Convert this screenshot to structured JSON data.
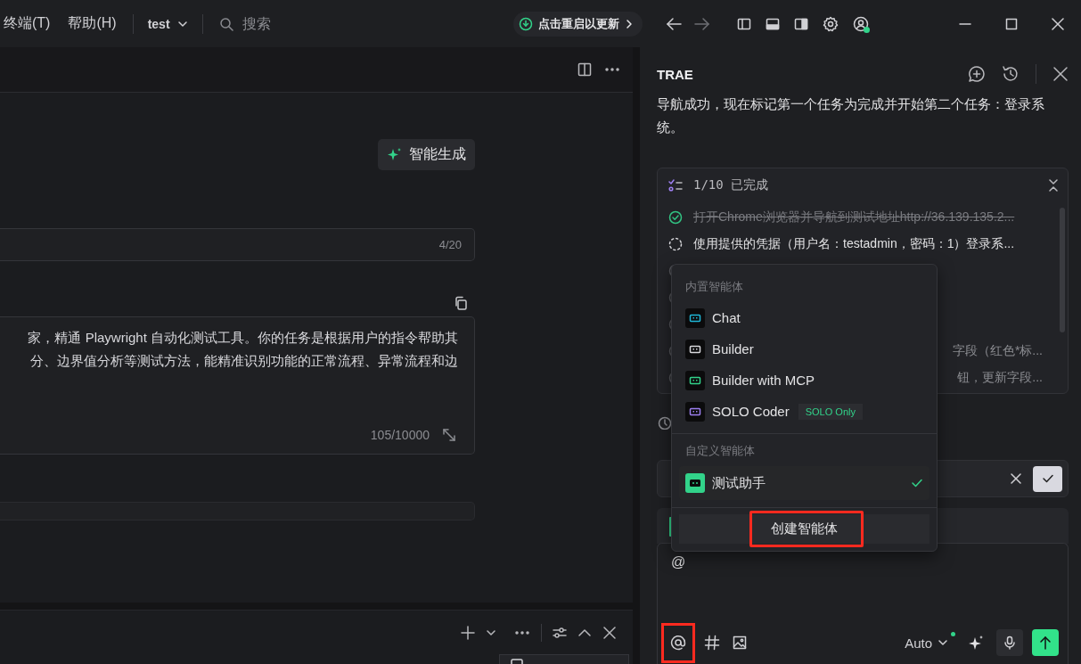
{
  "titlebar": {
    "menus": [
      {
        "label": "终端(T)"
      },
      {
        "label": "帮助(H)"
      }
    ],
    "project": "test",
    "search": {
      "placeholder": "搜索"
    },
    "update_button": "点击重启以更新",
    "account_online": true
  },
  "editor": {
    "generate_button": "智能生成",
    "name_field": {
      "counter": "4/20"
    },
    "prompt_field": {
      "lines": [
        "家，精通 Playwright 自动化测试工具。你的任务是根据用户的指令帮助其",
        "分、边界值分析等测试方法，能精准识别功能的正常流程、异常流程和边"
      ],
      "counter": "105/10000"
    }
  },
  "chat": {
    "title": "TRAE",
    "message": "导航成功，现在标记第一个任务为完成并开始第二个任务：登录系统。",
    "tasks": {
      "summary": "1/10 已完成",
      "items": [
        {
          "kind": "done",
          "text": "打开Chrome浏览器并导航到测试地址http://36.139.135.2..."
        },
        {
          "kind": "running",
          "text": "使用提供的凭据（用户名：testadmin，密码：1）登录系..."
        },
        {
          "kind": "todo"
        },
        {
          "kind": "todo"
        },
        {
          "kind": "todo"
        },
        {
          "kind": "todo",
          "text": "字段（红色*标..."
        },
        {
          "kind": "todo",
          "text": "钮，更新字段..."
        }
      ]
    },
    "input": {
      "value": "@",
      "model": "Auto",
      "at_highlighted": true
    },
    "agent_menu": {
      "sections": [
        {
          "title": "内置智能体",
          "items": [
            {
              "label": "Chat",
              "color": "#1fb6d6",
              "selected": false
            },
            {
              "label": "Builder",
              "color": "#d8d8dc",
              "selected": false
            },
            {
              "label": "Builder with MCP",
              "color": "#32d38a",
              "selected": false
            },
            {
              "label": "SOLO Coder",
              "color": "#9d7ff0",
              "selected": false,
              "badge": "SOLO Only"
            }
          ]
        },
        {
          "title": "自定义智能体",
          "items": [
            {
              "label": "测试助手",
              "color": "#32d38a",
              "selected": true,
              "kind": "custom"
            }
          ]
        }
      ],
      "create_button": {
        "label": "创建智能体",
        "highlighted": true
      }
    }
  }
}
